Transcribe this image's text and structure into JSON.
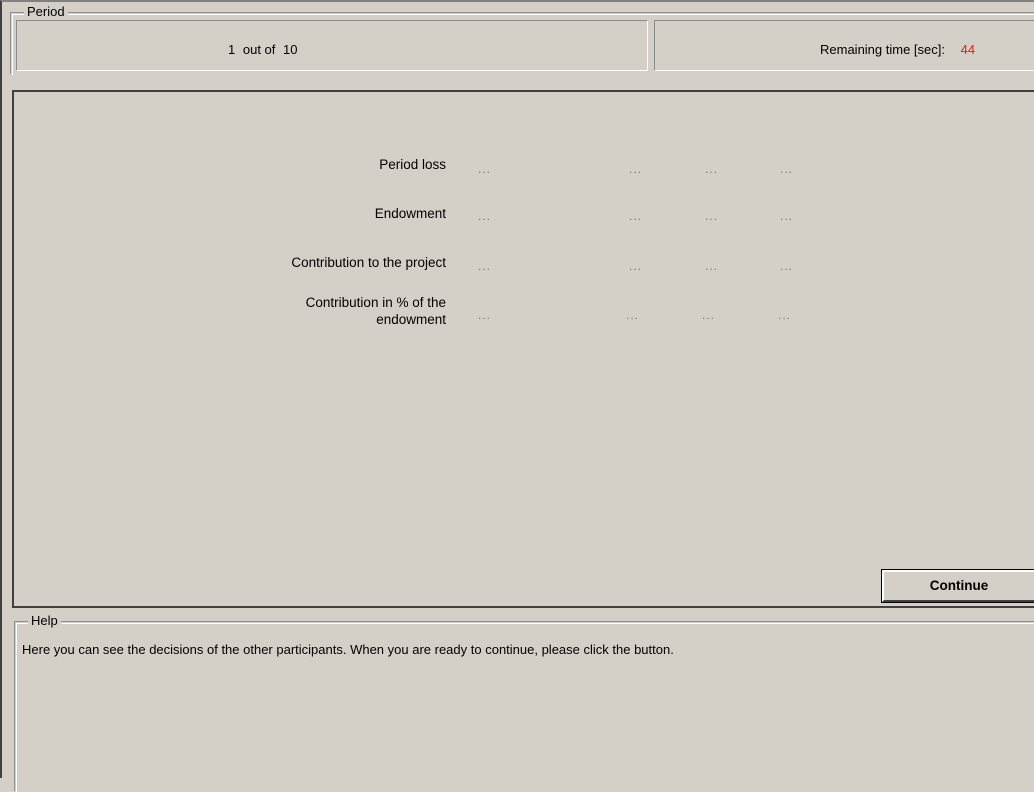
{
  "period": {
    "legend": "Period",
    "current": "1",
    "out_of_label": "out of",
    "total": "10",
    "remaining_label": "Remaining time [sec]:",
    "remaining_value": "44",
    "remaining_color": "#e0201a"
  },
  "results": {
    "rows": [
      {
        "label": "Period loss",
        "values": [
          "...",
          "...",
          "...",
          "..."
        ]
      },
      {
        "label": "Endowment",
        "values": [
          "...",
          "...",
          "...",
          "..."
        ]
      },
      {
        "label": "Contribution to the project",
        "values": [
          "...",
          "...",
          "...",
          "..."
        ]
      },
      {
        "label_line1": "Contribution in % of the",
        "label_line2": "endowment",
        "values": [
          "...",
          "...",
          "...",
          "..."
        ]
      }
    ]
  },
  "continue_button": {
    "label": "Continue"
  },
  "help": {
    "legend": "Help",
    "text": "Here you can see the decisions of the other participants. When you are ready to continue, please click the button."
  }
}
